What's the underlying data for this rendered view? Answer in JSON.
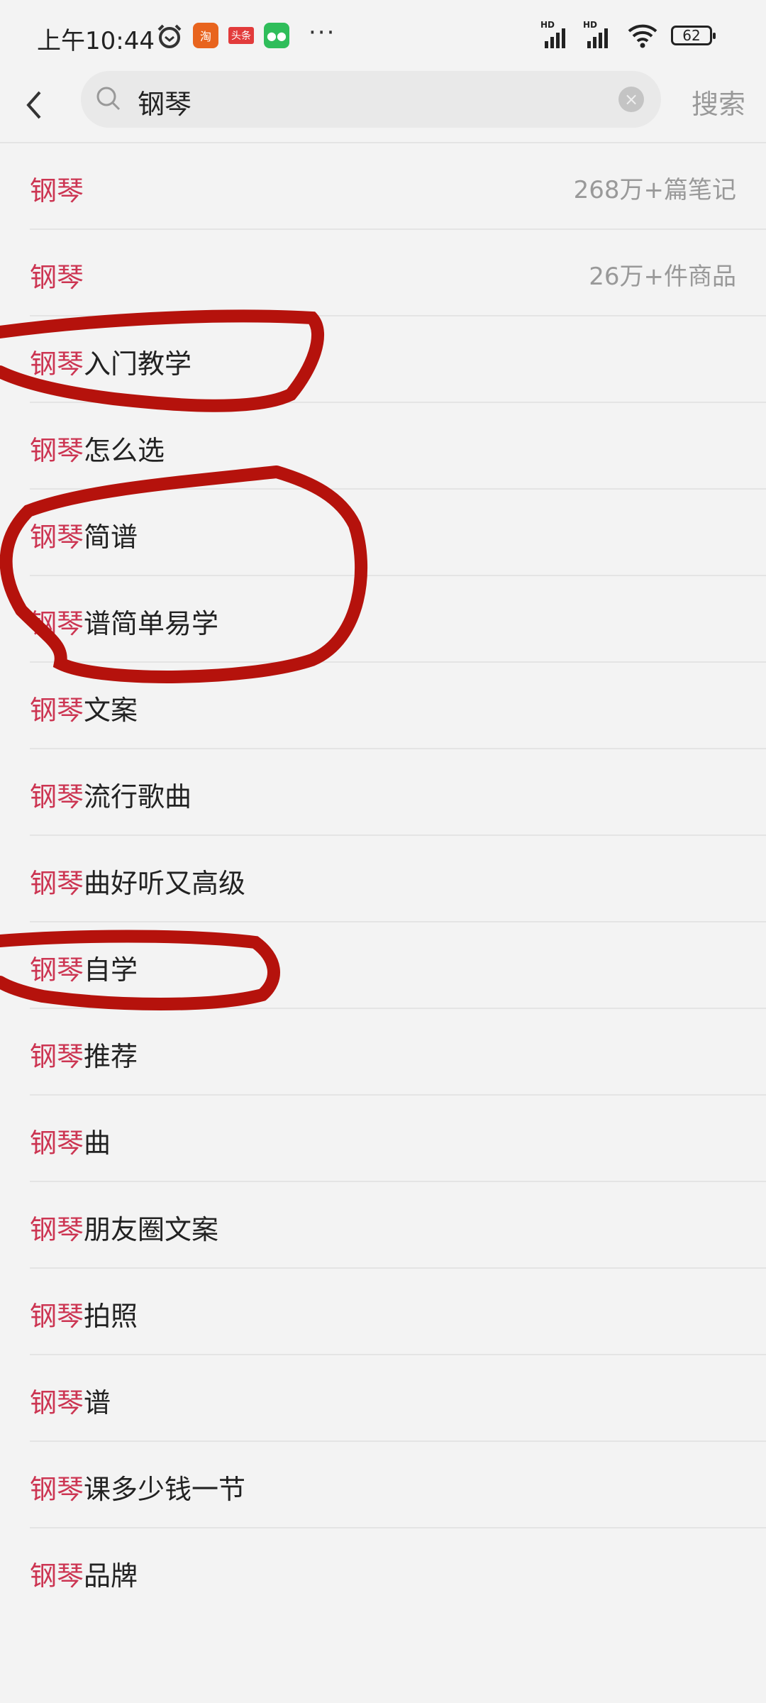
{
  "status_bar": {
    "time": "上午10:44",
    "notif_icons": [
      "alarm-icon",
      "taobao-icon",
      "toutiao-icon",
      "wechat-icon"
    ],
    "toutiao_text": "头条",
    "more": "···",
    "battery": "62",
    "signal": [
      "HD",
      "HD"
    ]
  },
  "search": {
    "query": "钢琴",
    "submit_label": "搜索"
  },
  "colors": {
    "highlight": "#cc3552",
    "annotation": "#b5120c"
  },
  "suggestions": [
    {
      "prefix": "钢琴",
      "suffix": "",
      "count": "268万+篇笔记"
    },
    {
      "prefix": "钢琴",
      "suffix": "",
      "count": "26万+件商品"
    },
    {
      "prefix": "钢琴",
      "suffix": "入门教学"
    },
    {
      "prefix": "钢琴",
      "suffix": "怎么选"
    },
    {
      "prefix": "钢琴",
      "suffix": "简谱"
    },
    {
      "prefix": "钢琴",
      "suffix": "谱简单易学"
    },
    {
      "prefix": "钢琴",
      "suffix": "文案"
    },
    {
      "prefix": "钢琴",
      "suffix": "流行歌曲"
    },
    {
      "prefix": "钢琴",
      "suffix": "曲好听又高级"
    },
    {
      "prefix": "钢琴",
      "suffix": "自学"
    },
    {
      "prefix": "钢琴",
      "suffix": "推荐"
    },
    {
      "prefix": "钢琴",
      "suffix": "曲"
    },
    {
      "prefix": "钢琴",
      "suffix": "朋友圈文案"
    },
    {
      "prefix": "钢琴",
      "suffix": "拍照"
    },
    {
      "prefix": "钢琴",
      "suffix": "谱"
    },
    {
      "prefix": "钢琴",
      "suffix": "课多少钱一节"
    },
    {
      "prefix": "钢琴",
      "suffix": "品牌"
    }
  ]
}
